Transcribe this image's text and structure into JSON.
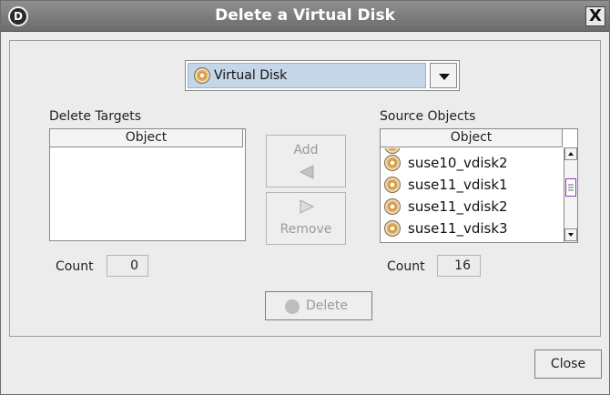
{
  "window": {
    "title": "Delete a Virtual Disk",
    "app_icon_letter": "D",
    "close_glyph": "X"
  },
  "type_selector": {
    "selected": "Virtual Disk",
    "icon": "virtual-disk-icon"
  },
  "delete_targets": {
    "label": "Delete Targets",
    "column_header": "Object",
    "items": [],
    "count_label": "Count",
    "count": "0"
  },
  "source_objects": {
    "label": "Source Objects",
    "column_header": "Object",
    "items": [
      {
        "name": "suse10_vdisk2",
        "icon": "virtual-disk-icon"
      },
      {
        "name": "suse11_vdisk1",
        "icon": "virtual-disk-icon"
      },
      {
        "name": "suse11_vdisk2",
        "icon": "virtual-disk-icon"
      },
      {
        "name": "suse11_vdisk3",
        "icon": "virtual-disk-icon"
      }
    ],
    "count_label": "Count",
    "count": "16"
  },
  "buttons": {
    "add": "Add",
    "remove": "Remove",
    "delete": "Delete",
    "close": "Close"
  },
  "colors": {
    "titlebar": "#7a7a7a",
    "selection": "#c4d6e7",
    "disabled_text": "#9a9a9a"
  }
}
